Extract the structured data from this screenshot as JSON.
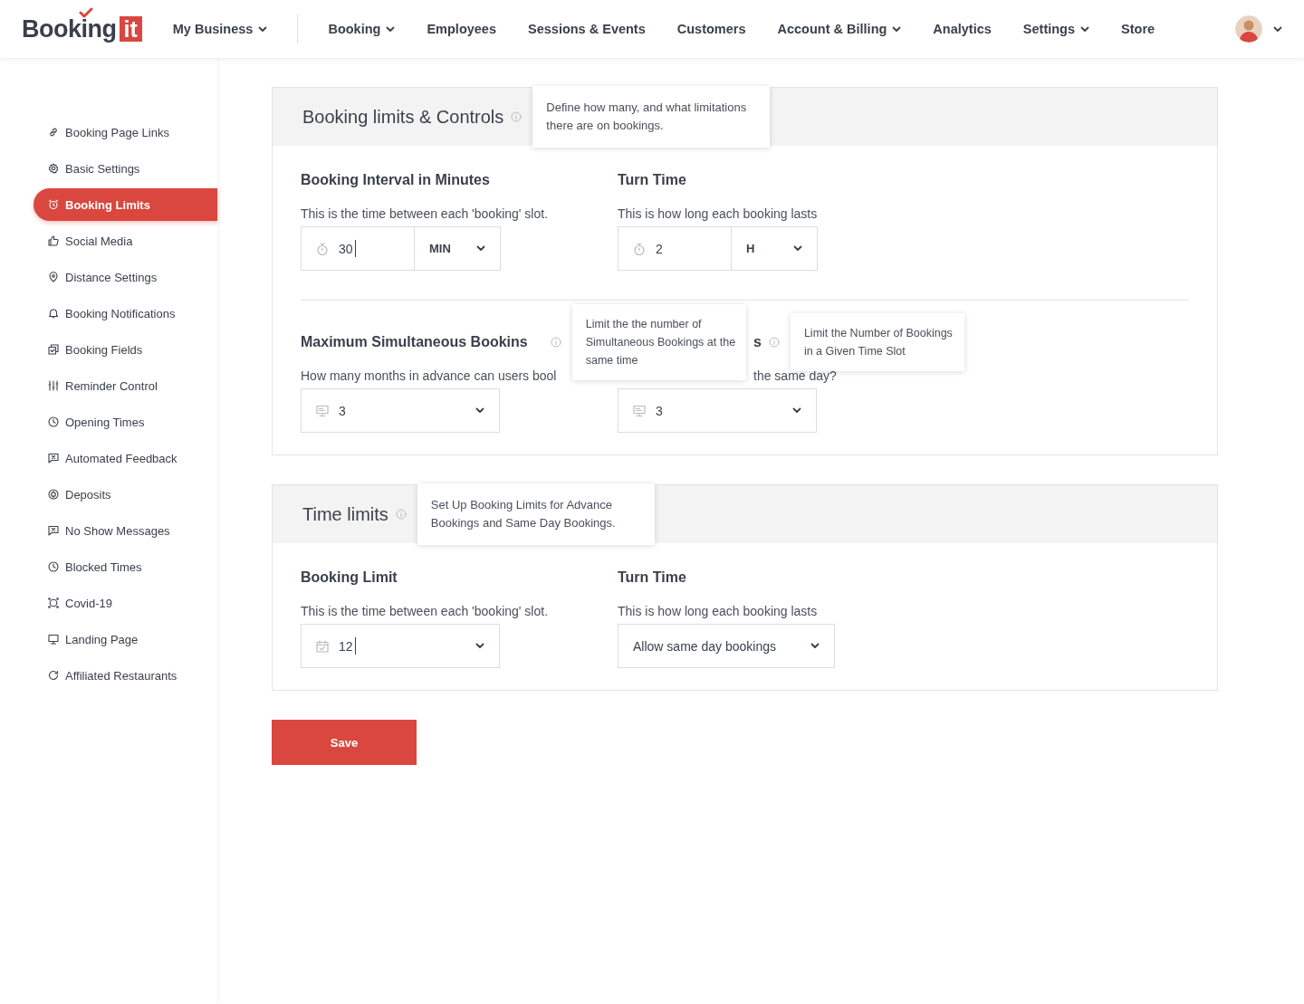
{
  "logo": {
    "text": "Booking",
    "badge": "it"
  },
  "nav": [
    {
      "label": "My Business",
      "dropdown": true,
      "divider_after": true
    },
    {
      "label": "Booking",
      "dropdown": true,
      "divider_after": false
    },
    {
      "label": "Employees",
      "dropdown": false,
      "divider_after": false
    },
    {
      "label": "Sessions & Events",
      "dropdown": false,
      "divider_after": false
    },
    {
      "label": "Customers",
      "dropdown": false,
      "divider_after": false
    },
    {
      "label": "Account & Billing",
      "dropdown": true,
      "divider_after": false
    },
    {
      "label": "Analytics",
      "dropdown": false,
      "divider_after": false
    },
    {
      "label": "Settings",
      "dropdown": true,
      "divider_after": false
    },
    {
      "label": "Store",
      "dropdown": false,
      "divider_after": false
    }
  ],
  "sidebar": {
    "items": [
      {
        "label": "Booking Page Links",
        "selected": false
      },
      {
        "label": "Basic Settings",
        "selected": false
      },
      {
        "label": "Booking Limits",
        "selected": true
      },
      {
        "label": "Social Media",
        "selected": false
      },
      {
        "label": "Distance Settings",
        "selected": false
      },
      {
        "label": "Booking Notifications",
        "selected": false
      },
      {
        "label": "Booking Fields",
        "selected": false
      },
      {
        "label": "Reminder Control",
        "selected": false
      },
      {
        "label": "Opening Times",
        "selected": false
      },
      {
        "label": "Automated Feedback",
        "selected": false
      },
      {
        "label": "Deposits",
        "selected": false
      },
      {
        "label": "No Show Messages",
        "selected": false
      },
      {
        "label": "Blocked Times",
        "selected": false
      },
      {
        "label": "Covid-19",
        "selected": false
      },
      {
        "label": "Landing Page",
        "selected": false
      },
      {
        "label": "Affiliated Restaurants",
        "selected": false
      }
    ]
  },
  "sections": [
    {
      "title": "Booking limits & Controls",
      "tooltip": "Define how many, and what limitations there are on bookings.",
      "rows": [
        [
          {
            "kind": "full",
            "label": "Booking Interval in Minutes",
            "description": "This is the time between each 'booking' slot.",
            "control": {
              "kind": "duration",
              "value": "30",
              "unit": "MIN",
              "focused": true
            }
          },
          {
            "kind": "full",
            "label": "Turn Time",
            "description": "This is how long each booking lasts",
            "control": {
              "kind": "duration",
              "value": "2",
              "unit": "H",
              "focused": false
            }
          }
        ],
        [
          {
            "kind": "full",
            "label": "Maximum Simultaneous Bookins",
            "tooltip": "Limit the the number of Simultaneous Bookings at the same time",
            "description": "How many months in advance can users bool",
            "control": {
              "kind": "count",
              "value": "3",
              "focused": false
            }
          },
          {
            "kind": "clipped",
            "label": "s",
            "tooltip": "Limit the Number of Bookings in a Given Time Slot",
            "description": "the same day?",
            "control": {
              "kind": "count",
              "value": "3",
              "focused": false
            }
          }
        ]
      ]
    },
    {
      "title": "Time limits",
      "tooltip": "Set Up Booking Limits for Advance Bookings and Same Day Bookings.",
      "rows": [
        [
          {
            "kind": "full",
            "label": "Booking Limit",
            "description": "This is the time between each 'booking' slot.",
            "control": {
              "kind": "date",
              "value": "12",
              "focused": true
            }
          },
          {
            "kind": "full",
            "label": "Turn Time",
            "description": "This is how long each booking lasts",
            "control": {
              "kind": "select",
              "value": "Allow same day bookings",
              "focused": false
            }
          }
        ]
      ]
    }
  ],
  "save_button": "Save"
}
